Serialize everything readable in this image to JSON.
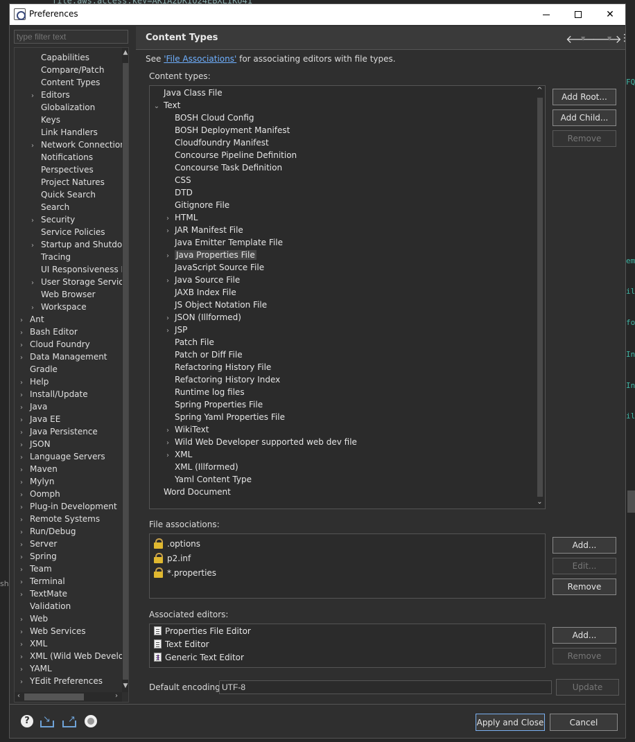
{
  "window": {
    "title": "Preferences"
  },
  "background": {
    "code_top": "file.aws.access.key=AKIA2DKIO24EBXLIKO41",
    "right_fragments": [
      "FQ",
      "em",
      "il",
      "fo",
      "In",
      "In",
      "il"
    ],
    "left_fragment": "sh"
  },
  "filter": {
    "placeholder": "type filter text"
  },
  "nav": {
    "items": [
      {
        "label": "Capabilities",
        "level": 2,
        "expandable": false
      },
      {
        "label": "Compare/Patch",
        "level": 2,
        "expandable": false
      },
      {
        "label": "Content Types",
        "level": 2,
        "expandable": false
      },
      {
        "label": "Editors",
        "level": 2,
        "expandable": true
      },
      {
        "label": "Globalization",
        "level": 2,
        "expandable": false
      },
      {
        "label": "Keys",
        "level": 2,
        "expandable": false
      },
      {
        "label": "Link Handlers",
        "level": 2,
        "expandable": false
      },
      {
        "label": "Network Connections",
        "level": 2,
        "expandable": true
      },
      {
        "label": "Notifications",
        "level": 2,
        "expandable": false
      },
      {
        "label": "Perspectives",
        "level": 2,
        "expandable": false
      },
      {
        "label": "Project Natures",
        "level": 2,
        "expandable": false
      },
      {
        "label": "Quick Search",
        "level": 2,
        "expandable": false
      },
      {
        "label": "Search",
        "level": 2,
        "expandable": false
      },
      {
        "label": "Security",
        "level": 2,
        "expandable": true
      },
      {
        "label": "Service Policies",
        "level": 2,
        "expandable": false
      },
      {
        "label": "Startup and Shutdown",
        "level": 2,
        "expandable": true
      },
      {
        "label": "Tracing",
        "level": 2,
        "expandable": false
      },
      {
        "label": "UI Responsiveness Monitoring",
        "level": 2,
        "expandable": false
      },
      {
        "label": "User Storage Service",
        "level": 2,
        "expandable": true
      },
      {
        "label": "Web Browser",
        "level": 2,
        "expandable": false
      },
      {
        "label": "Workspace",
        "level": 2,
        "expandable": true
      },
      {
        "label": "Ant",
        "level": 1,
        "expandable": true
      },
      {
        "label": "Bash Editor",
        "level": 1,
        "expandable": true
      },
      {
        "label": "Cloud Foundry",
        "level": 1,
        "expandable": true
      },
      {
        "label": "Data Management",
        "level": 1,
        "expandable": true
      },
      {
        "label": "Gradle",
        "level": 1,
        "expandable": false
      },
      {
        "label": "Help",
        "level": 1,
        "expandable": true
      },
      {
        "label": "Install/Update",
        "level": 1,
        "expandable": true
      },
      {
        "label": "Java",
        "level": 1,
        "expandable": true
      },
      {
        "label": "Java EE",
        "level": 1,
        "expandable": true
      },
      {
        "label": "Java Persistence",
        "level": 1,
        "expandable": true
      },
      {
        "label": "JSON",
        "level": 1,
        "expandable": true
      },
      {
        "label": "Language Servers",
        "level": 1,
        "expandable": true
      },
      {
        "label": "Maven",
        "level": 1,
        "expandable": true
      },
      {
        "label": "Mylyn",
        "level": 1,
        "expandable": true
      },
      {
        "label": "Oomph",
        "level": 1,
        "expandable": true
      },
      {
        "label": "Plug-in Development",
        "level": 1,
        "expandable": true
      },
      {
        "label": "Remote Systems",
        "level": 1,
        "expandable": true
      },
      {
        "label": "Run/Debug",
        "level": 1,
        "expandable": true
      },
      {
        "label": "Server",
        "level": 1,
        "expandable": true
      },
      {
        "label": "Spring",
        "level": 1,
        "expandable": true
      },
      {
        "label": "Team",
        "level": 1,
        "expandable": true
      },
      {
        "label": "Terminal",
        "level": 1,
        "expandable": true
      },
      {
        "label": "TextMate",
        "level": 1,
        "expandable": true
      },
      {
        "label": "Validation",
        "level": 1,
        "expandable": false
      },
      {
        "label": "Web",
        "level": 1,
        "expandable": true
      },
      {
        "label": "Web Services",
        "level": 1,
        "expandable": true
      },
      {
        "label": "XML",
        "level": 1,
        "expandable": true
      },
      {
        "label": "XML (Wild Web Developer)",
        "level": 1,
        "expandable": true
      },
      {
        "label": "YAML",
        "level": 1,
        "expandable": true
      },
      {
        "label": "YEdit Preferences",
        "level": 1,
        "expandable": true
      }
    ]
  },
  "page": {
    "title": "Content Types",
    "see_prefix": "See ",
    "see_link": "'File Associations'",
    "see_suffix": " for associating editors with file types.",
    "content_types_label": "Content types:",
    "file_assoc_label": "File associations:",
    "assoc_editors_label": "Associated editors:",
    "encoding_label": "Default encoding:",
    "encoding_value": "UTF-8"
  },
  "content_types": [
    {
      "label": "Java Class File",
      "level": 0,
      "chevron": "none"
    },
    {
      "label": "Text",
      "level": 0,
      "chevron": "open"
    },
    {
      "label": "BOSH Cloud Config",
      "level": 1,
      "chevron": "none"
    },
    {
      "label": "BOSH Deployment Manifest",
      "level": 1,
      "chevron": "none"
    },
    {
      "label": "Cloudfoundry Manifest",
      "level": 1,
      "chevron": "none"
    },
    {
      "label": "Concourse Pipeline Definition",
      "level": 1,
      "chevron": "none"
    },
    {
      "label": "Concourse Task Definition",
      "level": 1,
      "chevron": "none"
    },
    {
      "label": "CSS",
      "level": 1,
      "chevron": "none"
    },
    {
      "label": "DTD",
      "level": 1,
      "chevron": "none"
    },
    {
      "label": "Gitignore File",
      "level": 1,
      "chevron": "none"
    },
    {
      "label": "HTML",
      "level": 1,
      "chevron": "closed"
    },
    {
      "label": "JAR Manifest File",
      "level": 1,
      "chevron": "closed"
    },
    {
      "label": "Java Emitter Template File",
      "level": 1,
      "chevron": "none"
    },
    {
      "label": "Java Properties File",
      "level": 1,
      "chevron": "closed",
      "selected": true
    },
    {
      "label": "JavaScript Source File",
      "level": 1,
      "chevron": "none"
    },
    {
      "label": "Java Source File",
      "level": 1,
      "chevron": "closed"
    },
    {
      "label": "JAXB Index File",
      "level": 1,
      "chevron": "none"
    },
    {
      "label": "JS Object Notation File",
      "level": 1,
      "chevron": "none"
    },
    {
      "label": "JSON (Illformed)",
      "level": 1,
      "chevron": "closed"
    },
    {
      "label": "JSP",
      "level": 1,
      "chevron": "closed"
    },
    {
      "label": "Patch File",
      "level": 1,
      "chevron": "none"
    },
    {
      "label": "Patch or Diff File",
      "level": 1,
      "chevron": "none"
    },
    {
      "label": "Refactoring History File",
      "level": 1,
      "chevron": "none"
    },
    {
      "label": "Refactoring History Index",
      "level": 1,
      "chevron": "none"
    },
    {
      "label": "Runtime log files",
      "level": 1,
      "chevron": "none"
    },
    {
      "label": "Spring Properties File",
      "level": 1,
      "chevron": "none"
    },
    {
      "label": "Spring Yaml Properties File",
      "level": 1,
      "chevron": "none"
    },
    {
      "label": "WikiText",
      "level": 1,
      "chevron": "closed"
    },
    {
      "label": "Wild Web Developer supported web dev file",
      "level": 1,
      "chevron": "closed"
    },
    {
      "label": "XML",
      "level": 1,
      "chevron": "closed"
    },
    {
      "label": "XML (Illformed)",
      "level": 1,
      "chevron": "none"
    },
    {
      "label": "Yaml Content Type",
      "level": 1,
      "chevron": "none"
    },
    {
      "label": "Word Document",
      "level": 0,
      "chevron": "none"
    }
  ],
  "file_associations": [
    ".options",
    "p2.inf",
    "*.properties"
  ],
  "associated_editors": [
    {
      "label": "Properties File Editor",
      "icon": "properties-editor-icon"
    },
    {
      "label": "Text Editor",
      "icon": "text-editor-icon"
    },
    {
      "label": "Generic Text Editor",
      "icon": "generic-editor-icon"
    }
  ],
  "buttons": {
    "add_root": "Add Root...",
    "add_child": "Add Child...",
    "remove_ct": "Remove",
    "add_fa": "Add...",
    "edit_fa": "Edit...",
    "remove_fa": "Remove",
    "add_ed": "Add...",
    "remove_ed": "Remove",
    "update": "Update",
    "apply_close": "Apply and Close",
    "cancel": "Cancel"
  },
  "colors": {
    "accent": "#6fb0ff",
    "selection": "#464646",
    "lock": "#e0b830"
  }
}
